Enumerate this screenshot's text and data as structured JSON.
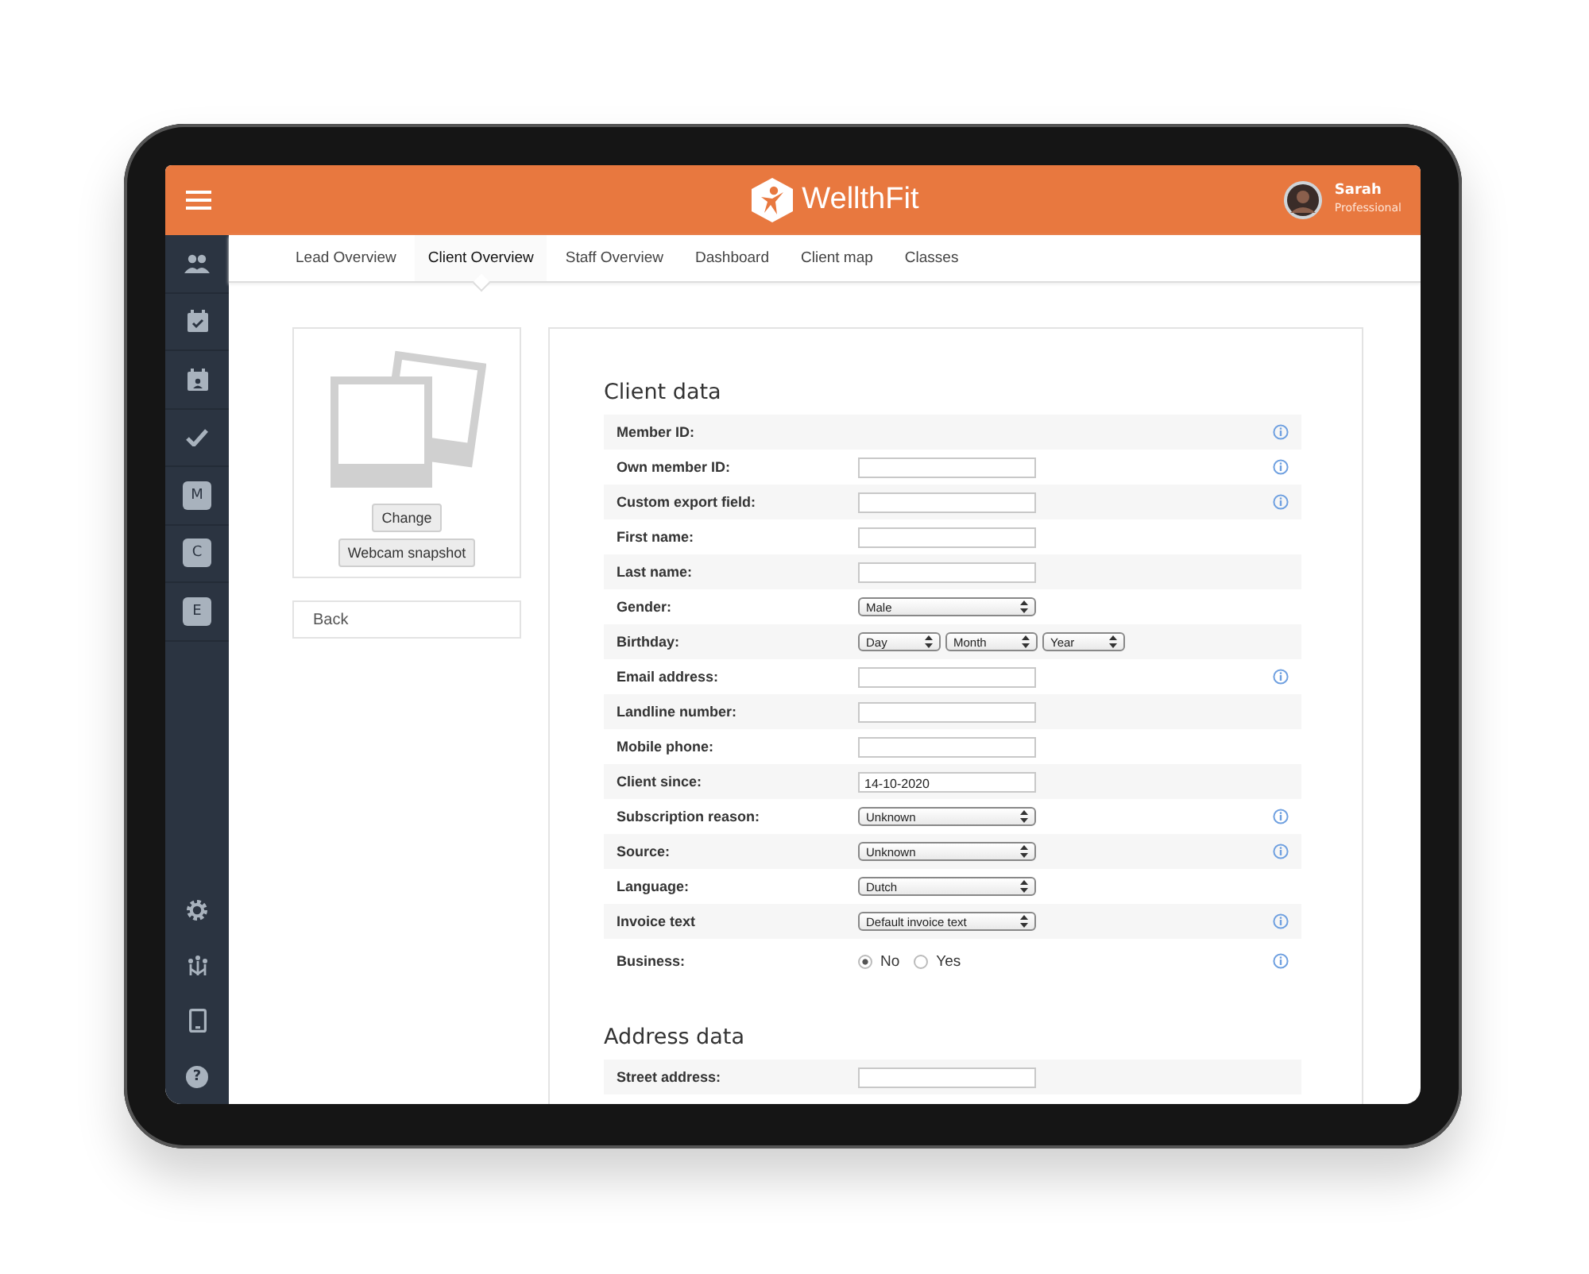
{
  "header": {
    "brand": "WellthFit",
    "user": {
      "name": "Sarah",
      "role": "Professional"
    }
  },
  "sidebar": {
    "items": [
      {
        "kind": "people"
      },
      {
        "kind": "calendar-check"
      },
      {
        "kind": "calendar-person"
      },
      {
        "kind": "check"
      },
      {
        "kind": "letter",
        "label": "M"
      },
      {
        "kind": "letter",
        "label": "C"
      },
      {
        "kind": "letter",
        "label": "E"
      }
    ],
    "bottom_items": [
      {
        "kind": "gear"
      },
      {
        "kind": "group"
      },
      {
        "kind": "tablet"
      },
      {
        "kind": "help",
        "label": "?"
      }
    ]
  },
  "tabs": [
    {
      "label": "Lead Overview",
      "selected": false
    },
    {
      "label": "Client Overview",
      "selected": true
    },
    {
      "label": "Staff Overview",
      "selected": false
    },
    {
      "label": "Dashboard",
      "selected": false
    },
    {
      "label": "Client map",
      "selected": false
    },
    {
      "label": "Classes",
      "selected": false
    }
  ],
  "photo_card": {
    "buttons": [
      "Change",
      "Webcam snapshot"
    ]
  },
  "back_button": "Back",
  "sections": [
    {
      "title": "Client data",
      "rows": [
        {
          "label": "Member ID:",
          "kind": "empty",
          "info": true
        },
        {
          "label": "Own member ID:",
          "kind": "input",
          "info": true
        },
        {
          "label": "Custom export field:",
          "kind": "input",
          "info": true
        },
        {
          "label": "First name:",
          "kind": "input",
          "info": false
        },
        {
          "label": "Last name:",
          "kind": "input",
          "info": false
        },
        {
          "label": "Gender:",
          "kind": "select",
          "selects": [
            "Male"
          ],
          "info": false
        },
        {
          "label": "Birthday:",
          "kind": "select",
          "selects": [
            "Day",
            "Month",
            "Year"
          ],
          "info": false
        },
        {
          "label": "Email address:",
          "kind": "input",
          "info": true
        },
        {
          "label": "Landline number:",
          "kind": "input",
          "info": false
        },
        {
          "label": "Mobile phone:",
          "kind": "input",
          "info": false
        },
        {
          "label": "Client since:",
          "kind": "input",
          "value": "14-10-2020",
          "info": false
        },
        {
          "label": "Subscription reason:",
          "kind": "select",
          "selects": [
            "Unknown"
          ],
          "info": true
        },
        {
          "label": "Source:",
          "kind": "select",
          "selects": [
            "Unknown"
          ],
          "info": true
        },
        {
          "label": "Language:",
          "kind": "select",
          "selects": [
            "Dutch"
          ],
          "info": false
        },
        {
          "label": "Invoice text",
          "kind": "select",
          "selects": [
            "Default invoice text"
          ],
          "info": true
        },
        {
          "label": "Business:",
          "kind": "radio",
          "options": [
            {
              "label": "No",
              "selected": true
            },
            {
              "label": "Yes",
              "selected": false
            }
          ],
          "info": true
        }
      ]
    },
    {
      "title": "Address data",
      "rows": [
        {
          "label": "Street address:",
          "kind": "input",
          "info": false
        }
      ]
    }
  ]
}
